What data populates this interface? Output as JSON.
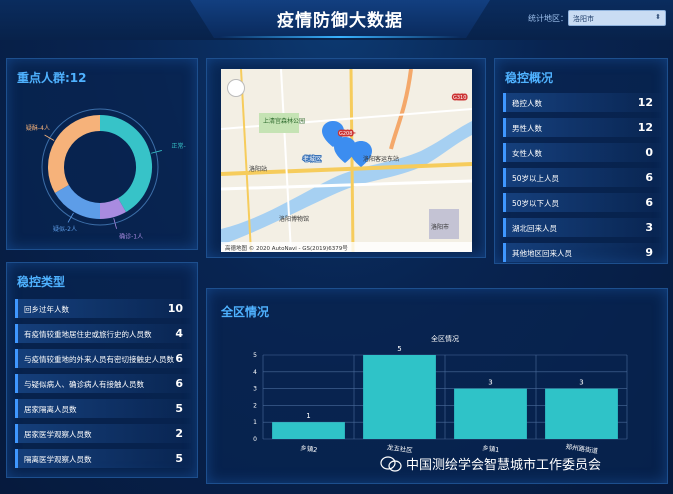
{
  "header": {
    "title": "疫情防御大数据",
    "region_label": "统计地区：",
    "region_value": "洛阳市"
  },
  "key_population": {
    "title": "重点人群:12",
    "donut": [
      {
        "label": "疑酥-4人",
        "value": 4,
        "color": "#f6b27a"
      },
      {
        "label": "正常-",
        "value": 5,
        "color": "#37c3c8"
      },
      {
        "label": "确诊-1人",
        "value": 1,
        "color": "#a98be0"
      },
      {
        "label": "疑似-2人",
        "value": 2,
        "color": "#5d9de8"
      }
    ]
  },
  "map": {
    "copyright": "高德地图 © 2020 AutoNavi - GS(2019)6379号",
    "labels": [
      "洛阳站",
      "上清宫森林公园",
      "老城区",
      "洛阳客运东站",
      "洛阳博物馆",
      "洛阳市",
      "G208",
      "G310"
    ]
  },
  "overview": {
    "title": "稳控概况",
    "items": [
      {
        "label": "稳控人数",
        "value": "12"
      },
      {
        "label": "男性人数",
        "value": "12"
      },
      {
        "label": "女性人数",
        "value": "0"
      },
      {
        "label": "50岁以上人员",
        "value": "6"
      },
      {
        "label": "50岁以下人员",
        "value": "6"
      },
      {
        "label": "湖北回来人员",
        "value": "3"
      },
      {
        "label": "其他地区回来人员",
        "value": "9"
      }
    ]
  },
  "control_types": {
    "title": "稳控类型",
    "items": [
      {
        "label": "回乡过年人数",
        "value": "10"
      },
      {
        "label": "有疫情较重地居住史或旅行史的人员数",
        "value": "4"
      },
      {
        "label": "与疫情较重地的外来人员有密切接触史人员数",
        "value": "6"
      },
      {
        "label": "与疑似病人、确诊病人有接触人员数",
        "value": "6"
      },
      {
        "label": "居家隔离人员数",
        "value": "5"
      },
      {
        "label": "居家医学观察人员数",
        "value": "2"
      },
      {
        "label": "隔离医学观察人员数",
        "value": "5"
      }
    ]
  },
  "district": {
    "title": "全区情况",
    "chart_title": "全区情况"
  },
  "chart_data": {
    "type": "bar",
    "title": "全区情况",
    "categories": [
      "乡镇2",
      "龙五社区",
      "乡镇1",
      "郑州路街道"
    ],
    "values": [
      1,
      5,
      3,
      3
    ],
    "ylim": [
      0,
      5
    ],
    "yticks": [
      0,
      1,
      2,
      3,
      4,
      5
    ],
    "bar_color": "#2fc3c8",
    "grid": true
  },
  "watermark": {
    "text": "中国测绘学会智慧城市工作委员会"
  }
}
